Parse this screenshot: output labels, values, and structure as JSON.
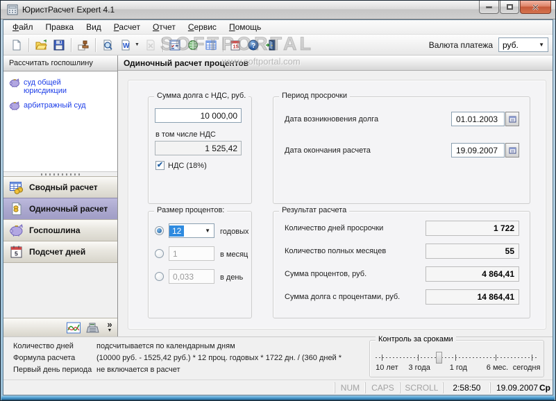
{
  "window": {
    "title": "ЮристРасчет Expert 4.1"
  },
  "menu": {
    "items": [
      "Файл",
      "Правка",
      "Вид",
      "Расчет",
      "Отчет",
      "Сервис",
      "Помощь"
    ]
  },
  "toolbar": {
    "icons": [
      "new-document",
      "open-folder",
      "save",
      "requisites-stamp",
      "print-preview",
      "export-word",
      "export-disabled",
      "calc-settings",
      "refinance-globe",
      "rates-table",
      "calendar",
      "help",
      "exit"
    ],
    "currency_label": "Валюта платежа",
    "currency_value": "руб."
  },
  "watermarks": {
    "toolbar": "SOFTPORTAL",
    "header": "www.softportal.com"
  },
  "sidebar": {
    "header": "Рассчитать госпошлину",
    "links": [
      "суд общей юрисдикции",
      "арбитражный суд"
    ],
    "nav": [
      {
        "label": "Сводный расчет",
        "selected": false
      },
      {
        "label": "Одиночный расчет",
        "selected": true
      },
      {
        "label": "Госпошлина",
        "selected": false
      },
      {
        "label": "Подсчет дней",
        "selected": false
      }
    ],
    "more_chevron": "»"
  },
  "main": {
    "header": "Одиночный расчет процентов",
    "debt": {
      "title": "Сумма долга с НДС, руб.",
      "amount": "10 000,00",
      "vat_label": "в том числе НДС",
      "vat_value": "1 525,42",
      "vat_check": "НДС (18%)"
    },
    "period": {
      "title": "Период просрочки",
      "row1_label": "Дата возникновения долга",
      "row1_value": "01.01.2003",
      "row2_label": "Дата окончания расчета",
      "row2_value": "19.09.2007"
    },
    "rate": {
      "title": "Размер процентов:",
      "opt1_value": "12",
      "opt1_label": "годовых",
      "opt2_value": "1",
      "opt2_label": "в месяц",
      "opt3_value": "0,033",
      "opt3_label": "в день"
    },
    "result": {
      "title": "Результат расчета",
      "rows": [
        {
          "label": "Количество дней просрочки",
          "value": "1 722"
        },
        {
          "label": "Количество полных месяцев",
          "value": "55"
        },
        {
          "label": "Сумма процентов, руб.",
          "value": "4 864,41"
        },
        {
          "label": "Сумма долга с процентами, руб.",
          "value": "14 864,41"
        }
      ]
    }
  },
  "footer": {
    "rows": [
      {
        "label": "Количество дней",
        "value": "подсчитывается по календарным дням"
      },
      {
        "label": "Формула расчета",
        "value": "(10000 руб. - 1525,42 руб.) * 12 проц. годовых * 1722 дн. / (360 дней *"
      },
      {
        "label": "Первый день периода",
        "value": "не включается в расчет"
      }
    ],
    "control": {
      "title": "Контроль за сроками",
      "labels": [
        "10 лет",
        "3 года",
        "1 год",
        "6 мес.",
        "сегодня"
      ]
    }
  },
  "statusbar": {
    "num": "NUM",
    "caps": "CAPS",
    "scroll": "SCROLL",
    "time": "2:58:50",
    "date": "19.09.2007",
    "day": "Ср"
  },
  "colors": {
    "selected_nav": "#aca9cf",
    "link_blue": "#1b3ce8",
    "close_button": "#c65a3a",
    "combo_selection": "#2f8be0"
  }
}
